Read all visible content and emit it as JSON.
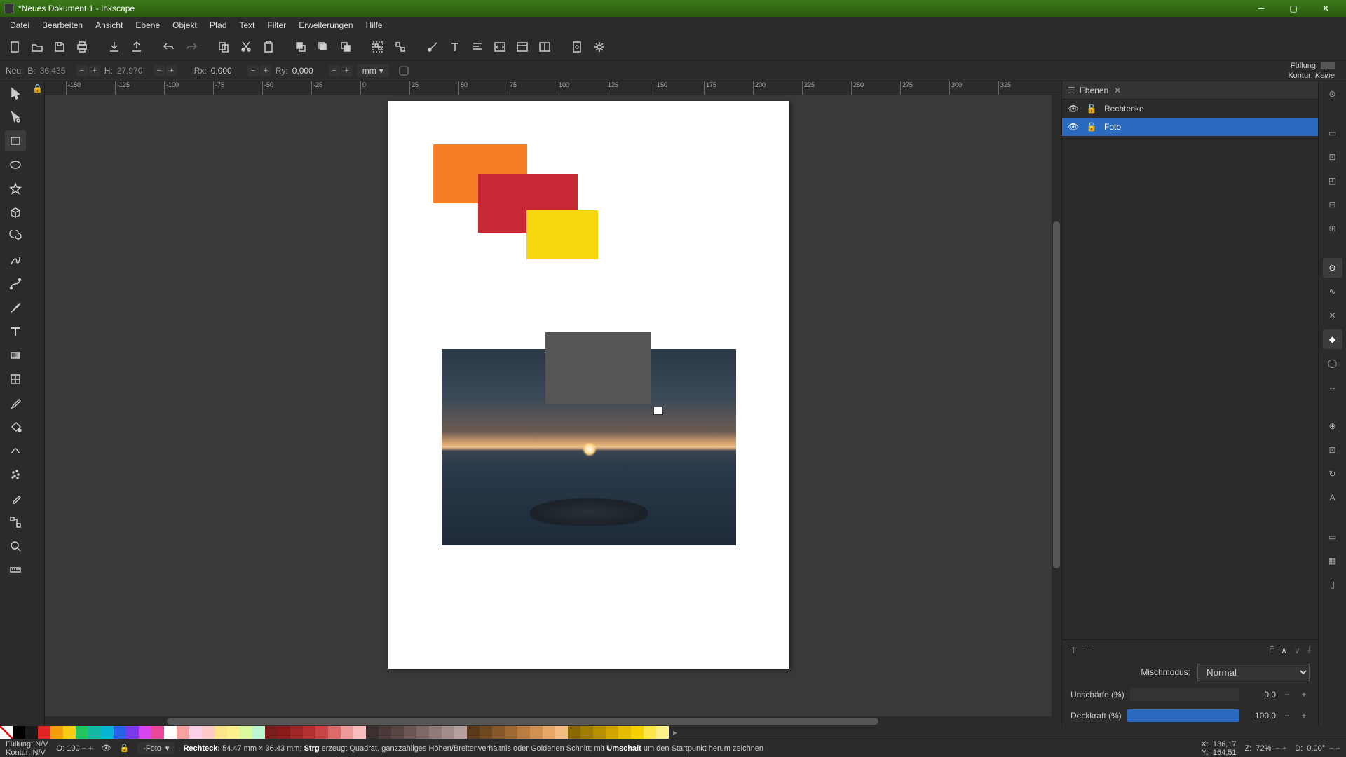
{
  "title": "*Neues Dokument 1 - Inkscape",
  "menu": [
    "Datei",
    "Bearbeiten",
    "Ansicht",
    "Ebene",
    "Objekt",
    "Pfad",
    "Text",
    "Filter",
    "Erweiterungen",
    "Hilfe"
  ],
  "optbar": {
    "neu": "Neu:",
    "b_lbl": "B:",
    "b_val": "36,435",
    "h_lbl": "H:",
    "h_val": "27,970",
    "rx_lbl": "Rx:",
    "rx_val": "0,000",
    "ry_lbl": "Ry:",
    "ry_val": "0,000",
    "unit": "mm"
  },
  "fill_lbl": "Füllung:",
  "kontur_lbl": "Kontur:",
  "kontur_val": "Keine",
  "ruler_ticks": [
    "-150",
    "-125",
    "-100",
    "-75",
    "-50",
    "-25",
    "0",
    "25",
    "50",
    "75",
    "100",
    "125",
    "150",
    "175",
    "200",
    "225",
    "250",
    "275",
    "300",
    "325"
  ],
  "panel": {
    "tab": "Ebenen",
    "layers": [
      {
        "name": "Rechtecke",
        "selected": false
      },
      {
        "name": "Foto",
        "selected": true
      }
    ],
    "blend_lbl": "Mischmodus:",
    "blend_val": "Normal",
    "blur_lbl": "Unschärfe (%)",
    "blur_val": "0,0",
    "opacity_lbl": "Deckkraft (%)",
    "opacity_val": "100,0"
  },
  "status": {
    "fuellung_lbl": "Füllung:",
    "fuellung_val": "N/V",
    "kontur_lbl": "Kontur:",
    "kontur_val": "N/V",
    "o_lbl": "O:",
    "o_val": "100",
    "layer": "-Foto",
    "hint_pre": "Rechteck:",
    "hint_dim": " 54.47 mm × 36.43 mm; ",
    "hint_k1": "Strg",
    "hint_m1": " erzeugt Quadrat, ganzzahliges Höhen/Breitenverhältnis oder Goldenen Schnitt; mit ",
    "hint_k2": "Umschalt",
    "hint_m2": " um den Startpunkt herum zeichnen",
    "x_lbl": "X:",
    "x_val": "136,17",
    "y_lbl": "Y:",
    "y_val": "164,51",
    "z_lbl": "Z:",
    "z_val": "72%",
    "d_lbl": "D:",
    "d_val": "0,00°"
  },
  "palette_colors": [
    "#000",
    "#1a1a1a",
    "#e02424",
    "#f59e0b",
    "#facc15",
    "#22c55e",
    "#14b8a6",
    "#06b6d4",
    "#2563eb",
    "#7c3aed",
    "#d946ef",
    "#ec4899",
    "#fff",
    "#f7a1a1",
    "#fbcfe8",
    "#fecaca",
    "#fde68a",
    "#fef08a",
    "#d9f99d",
    "#bbf7d0",
    "#7a1d1d",
    "#8b1a1a",
    "#9f2626",
    "#b33030",
    "#c94444",
    "#dd6b6b",
    "#ef9a9a",
    "#f7bcbc",
    "#3b2f2f",
    "#4a3a3a",
    "#5a4545",
    "#6e5555",
    "#806767",
    "#927a7a",
    "#a48d8d",
    "#b6a0a0",
    "#5a3a1a",
    "#6e4820",
    "#85582a",
    "#9f6a34",
    "#b87d3f",
    "#d29150",
    "#e8a766",
    "#f5bd82",
    "#8a6a00",
    "#a07c00",
    "#b89000",
    "#d2a600",
    "#e8bc00",
    "#f7d200",
    "#ffe64a",
    "#fff08a"
  ]
}
